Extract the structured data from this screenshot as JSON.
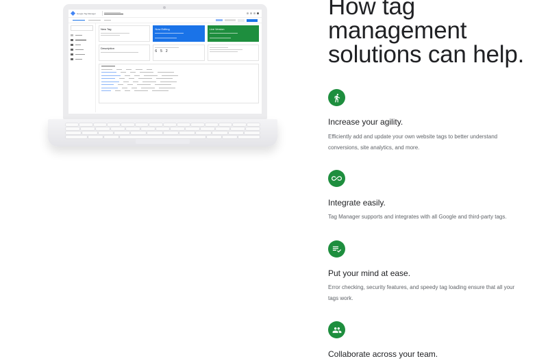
{
  "laptop_screen": {
    "app_title": "Google Tag Manager",
    "cards": [
      {
        "title": "New Tag",
        "style": "white"
      },
      {
        "title": "Now Editing",
        "style": "blue"
      },
      {
        "title": "Live Version",
        "style": "green"
      }
    ],
    "lower_cards": [
      {
        "title": "Description"
      },
      {
        "title": "",
        "stats": [
          "6",
          "5",
          "2"
        ]
      }
    ]
  },
  "hero": {
    "title": "How tag management solutions can help."
  },
  "features": [
    {
      "icon": "running-person-icon",
      "title": "Increase your agility.",
      "description": "Efficiently add and update your own website tags to better understand conversions, site analytics, and more."
    },
    {
      "icon": "infinity-icon",
      "title": "Integrate easily.",
      "description": "Tag Manager supports and integrates with all Google and third-party tags."
    },
    {
      "icon": "checklist-icon",
      "title": "Put your mind at ease.",
      "description": "Error checking, security features, and speedy tag loading ensure that all your tags work."
    },
    {
      "icon": "people-group-icon",
      "title": "Collaborate across your team.",
      "description": ""
    }
  ],
  "colors": {
    "accent_green": "#1e8e3e",
    "accent_blue": "#1a73e8",
    "text_primary": "#202124",
    "text_secondary": "#5f6368"
  }
}
